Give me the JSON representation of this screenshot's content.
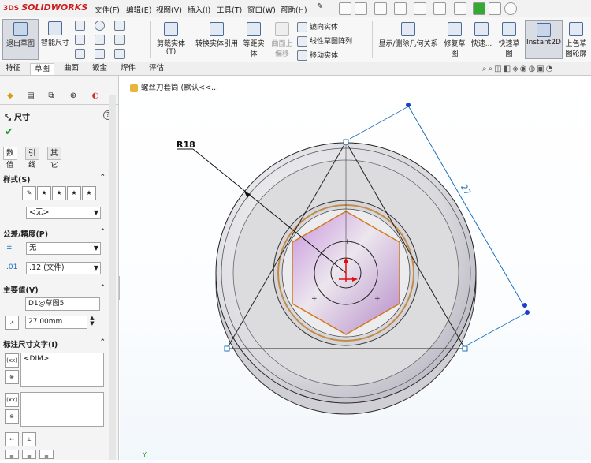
{
  "app": {
    "logo_prefix": "3DS",
    "logo_text": "SOLIDWORKS"
  },
  "menu": [
    "文件(F)",
    "编辑(E)",
    "视图(V)",
    "插入(I)",
    "工具(T)",
    "窗口(W)",
    "帮助(H)"
  ],
  "ribbon": {
    "exit_sketch": "退出草图",
    "smart_dimension": "智能尺寸",
    "trim_entities": "剪裁实体(T)",
    "convert_entities": "转换实体引用",
    "offset_entities": "等距实体",
    "offset_on_surface": "曲面上偏移",
    "mirror_entities": "镜向实体",
    "linear_pattern": "线性草图阵列",
    "move_entities": "移动实体",
    "display_relations": "显示/删除几何关系",
    "repair_sketch": "修复草图",
    "quick_snaps": "快速...",
    "rapid_sketch": "快速草图",
    "instant2d": "Instant2D",
    "shaded_sketch": "上色草图轮廓"
  },
  "tabs": [
    "特征",
    "草图",
    "曲面",
    "钣金",
    "焊件",
    "评估"
  ],
  "active_tab": "草图",
  "panel": {
    "title": "尺寸",
    "subtabs": [
      "数值",
      "引线",
      "其它"
    ],
    "style_label": "样式(S)",
    "style_value": "<无>",
    "tolerance_label": "公差/精度(P)",
    "tolerance_value": "无",
    "precision_value": ".12 (文件)",
    "primary_label": "主要值(V)",
    "primary_name": "D1@草图5",
    "primary_value": "27.00mm",
    "dim_text_label": "标注尺寸文字(I)",
    "dim_text": "<DIM>"
  },
  "tree": {
    "part_name": "螺丝刀套筒 (默认<<..."
  },
  "annotations": {
    "radius_label": "R18",
    "side_dim": "27"
  },
  "colors": {
    "accent": "#1b6fb8",
    "hex_fill": "#c9a0d6",
    "hex_edge": "#d27a1e",
    "ok": "#1a9b2c"
  }
}
